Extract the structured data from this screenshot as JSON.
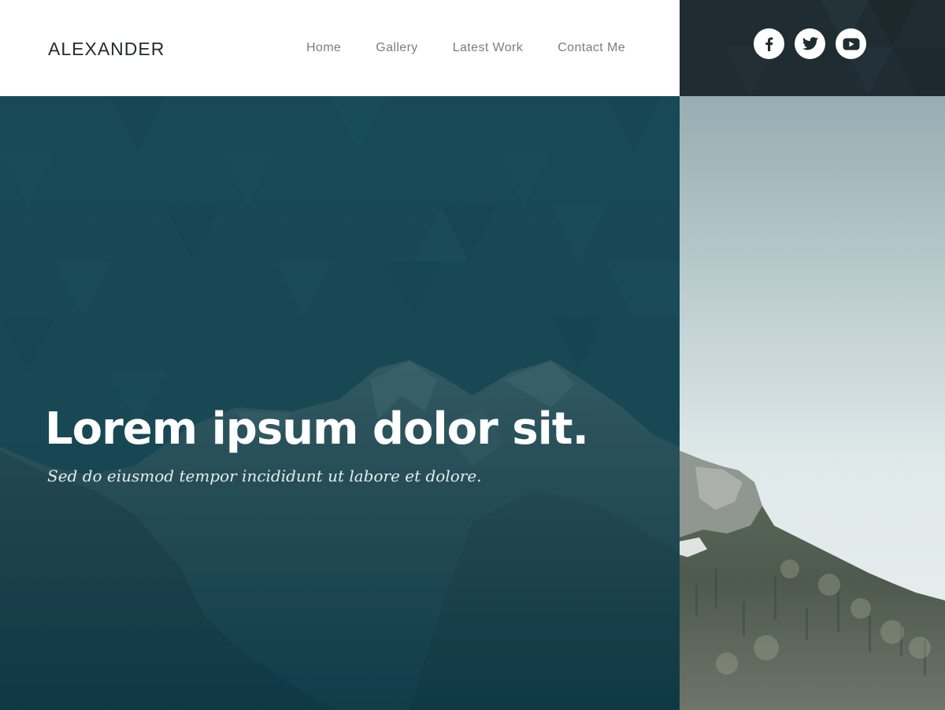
{
  "header": {
    "logo": "ALEXANDER",
    "nav": [
      {
        "label": "Home"
      },
      {
        "label": "Gallery"
      },
      {
        "label": "Latest Work"
      },
      {
        "label": "Contact Me"
      }
    ]
  },
  "social": [
    {
      "icon": "facebook-icon"
    },
    {
      "icon": "twitter-icon"
    },
    {
      "icon": "youtube-icon"
    }
  ],
  "hero": {
    "title": "Lorem ipsum dolor sit.",
    "subtitle": "Sed do eiusmod tempor incididunt ut labore et dolore."
  },
  "colors": {
    "header_bg": "#ffffff",
    "social_bar_bg": "#1f2c31",
    "hero_overlay": "#174a55",
    "nav_text": "#7a7d80",
    "logo_text": "#262b2e",
    "hero_text": "#ffffff"
  }
}
